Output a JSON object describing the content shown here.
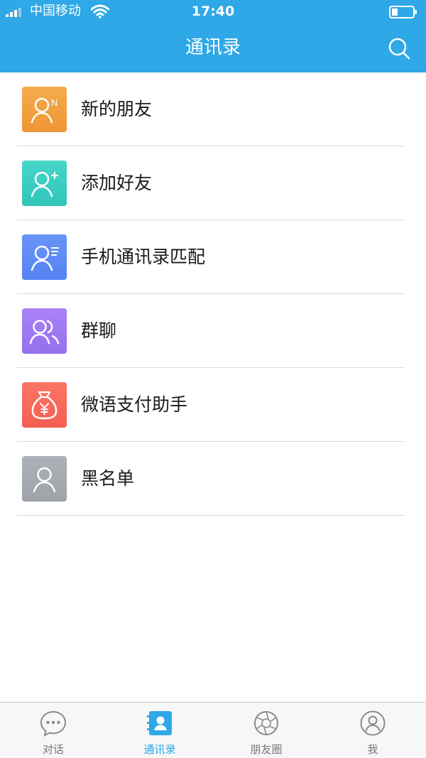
{
  "status_bar": {
    "carrier": "中国移动",
    "time": "17:40"
  },
  "header": {
    "title": "通讯录",
    "search_icon": "search-icon"
  },
  "colors": {
    "brand": "#2ea8e6",
    "new_friends": "#f0a340",
    "add_friend": "#3fd0c4",
    "contacts_match": "#5f8df6",
    "group_chat": "#a07af2",
    "pay_assistant": "#f86c5d",
    "blacklist": "#a7acb2"
  },
  "list": {
    "items": [
      {
        "label": "新的朋友",
        "icon": "new-friends-icon"
      },
      {
        "label": "添加好友",
        "icon": "add-friend-icon"
      },
      {
        "label": "手机通讯录匹配",
        "icon": "phone-contacts-icon"
      },
      {
        "label": "群聊",
        "icon": "group-chat-icon"
      },
      {
        "label": "微语支付助手",
        "icon": "money-bag-icon"
      },
      {
        "label": "黑名单",
        "icon": "blacklist-user-icon"
      }
    ]
  },
  "tabbar": {
    "tabs": [
      {
        "label": "对话",
        "icon": "chat-bubble-icon",
        "active": false
      },
      {
        "label": "通讯录",
        "icon": "contacts-book-icon",
        "active": true
      },
      {
        "label": "朋友圈",
        "icon": "aperture-icon",
        "active": false
      },
      {
        "label": "我",
        "icon": "profile-icon",
        "active": false
      }
    ]
  }
}
